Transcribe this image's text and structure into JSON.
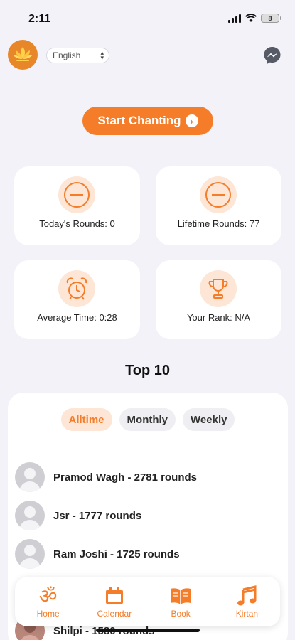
{
  "status": {
    "time": "2:11",
    "battery": "8"
  },
  "header": {
    "language": "English"
  },
  "start_button": {
    "label": "Start Chanting"
  },
  "stats": [
    {
      "label": "Today's Rounds: 0",
      "icon": "minus-circle-icon"
    },
    {
      "label": "Lifetime Rounds: 77",
      "icon": "minus-circle-icon"
    },
    {
      "label": "Average Time: 0:28",
      "icon": "alarm-clock-icon"
    },
    {
      "label": "Your Rank: N/A",
      "icon": "trophy-icon"
    }
  ],
  "leaderboard": {
    "title": "Top 10",
    "tabs": [
      "Alltime",
      "Monthly",
      "Weekly"
    ],
    "active_tab": "Alltime",
    "entries": [
      {
        "name": "Pramod Wagh - 2781 rounds"
      },
      {
        "name": "Jsr - 1777 rounds"
      },
      {
        "name": "Ram Joshi - 1725 rounds"
      },
      {
        "name": ""
      },
      {
        "name": "Shilpi - 1580 rounds"
      }
    ]
  },
  "nav": {
    "items": [
      {
        "label": "Home",
        "icon": "om-icon"
      },
      {
        "label": "Calendar",
        "icon": "calendar-icon"
      },
      {
        "label": "Book",
        "icon": "book-icon"
      },
      {
        "label": "Kirtan",
        "icon": "music-note-icon"
      }
    ]
  },
  "colors": {
    "accent": "#f57c28",
    "accent_light": "#fde6d6",
    "background": "#f2f2f8"
  }
}
